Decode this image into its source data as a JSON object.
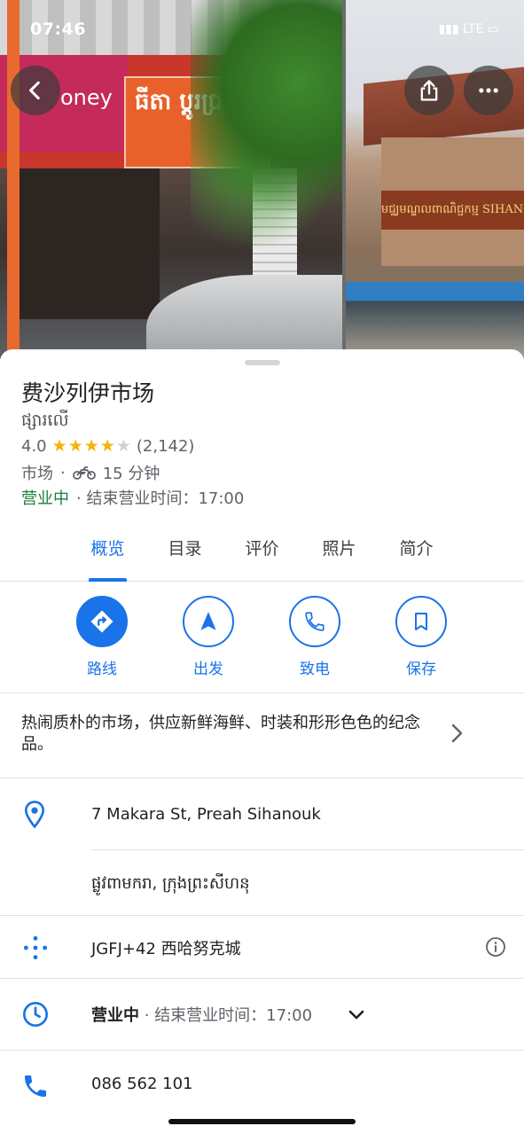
{
  "status_bar": {
    "time": "07:46",
    "signal_text": "LTE"
  },
  "header": {
    "sign_text": "ធីតា ប្ដូរប្រាក់",
    "sign_brand": "oney",
    "gate_banner": "មជ្ឈមណ្ឌលពាណិជ្ជកម្ម SIHANOUKVILLE T"
  },
  "place": {
    "title": "费沙列伊市场",
    "subtitle": "ផ្សារលើ",
    "rating": "4.0",
    "stars": 4,
    "reviews": "(2,142)",
    "category": "市场",
    "travel_time": "15 分钟",
    "open_status": "营业中",
    "close_info": "· 结束营业时间：17:00"
  },
  "tabs": [
    "概览",
    "目录",
    "评价",
    "照片",
    "简介"
  ],
  "actions": {
    "directions": "路线",
    "start": "出发",
    "call": "致电",
    "save": "保存"
  },
  "description": "热闹质朴的市场，供应新鲜海鲜、时装和形形色色的纪念品。",
  "info": {
    "address_line1": "7 Makara St, Preah Sihanouk",
    "address_line2": "ផ្លូវពាមករា, ក្រុងព្រះសីហនុ",
    "plus_code": "JGFJ+42 西哈努克城",
    "hours_status": "营业中",
    "hours_close": "· 结束营业时间：17:00",
    "phone": "086 562 101"
  },
  "colors": {
    "accent": "#1a73e8",
    "open": "#188038",
    "star": "#f6b400"
  }
}
